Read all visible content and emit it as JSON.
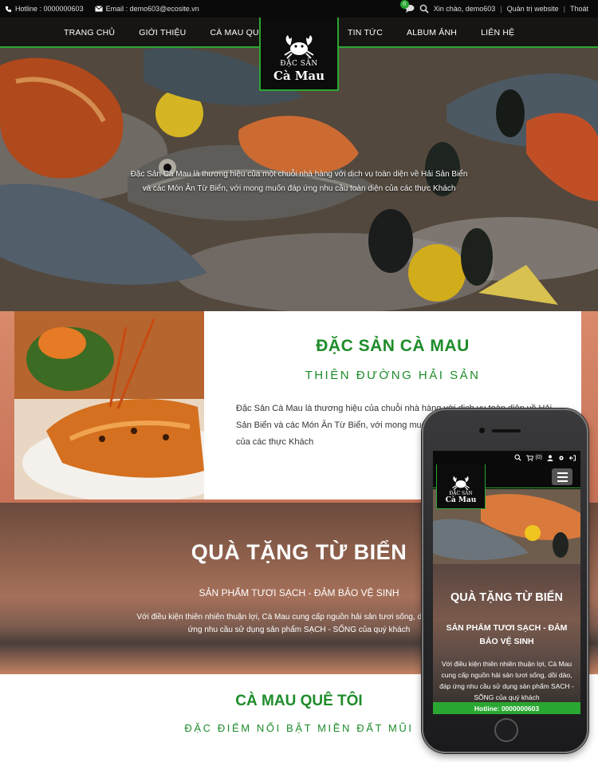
{
  "topbar": {
    "hotline": "Hotline : 0000000603",
    "email": "Email : demo603@ecosite.vn",
    "cart_count": "0",
    "greeting": "Xin chào, demo603",
    "admin_link": "Quản trị website",
    "logout_link": "Thoát",
    "separator": "|"
  },
  "nav": {
    "left_items": [
      "TRANG CHỦ",
      "GIỚI THIỆU",
      "CÀ MAU QUÊ TÔI"
    ],
    "right_items": [
      "TIN TỨC",
      "ALBUM ẢNH",
      "LIÊN HỆ"
    ]
  },
  "logo": {
    "line1": "ĐẶC SẢN",
    "line2": "Cà Mau"
  },
  "hero": {
    "line1": "Đặc Sản Cà Mau là thương hiệu của một chuỗi nhà hàng với dịch vụ toàn diện về Hải Sản Biển",
    "line2": "và các Món Ăn Từ Biển, với mong muốn đáp ứng nhu cầu toàn diện của các thực Khách"
  },
  "about": {
    "title": "ĐẶC SẢN CÀ MAU",
    "subtitle": "THIÊN ĐƯỜNG HẢI SẢN",
    "description": "Đặc Sản Cà Mau là thương hiệu của chuỗi nhà hàng với dịch vụ toàn diện về Hải Sản Biển và các Món Ăn Từ Biển, với mong muốn đáp ứng nhu cầu toàn diện của các thực Khách"
  },
  "gift": {
    "title": "QUÀ TẶNG TỪ BIỂN",
    "subtitle": "SẢN PHẨM TƯƠI SẠCH - ĐẢM BẢO VỆ SINH",
    "description": "Với điều kiện thiên nhiên thuận lợi, Cà Mau cung cấp nguồn hải sản tươi sống, dồi dào, đáp ứng nhu cầu sử dụng sản phẩm SẠCH - SỐNG của quý khách"
  },
  "home_section": {
    "title": "CÀ MAU QUÊ TÔI",
    "subtitle": "ĐẶC ĐIỂM NỔI BẬT MIỀN ĐẤT MŨI"
  },
  "mobile": {
    "cart_label": "(0)",
    "logo_line1": "ĐẶC SẢN",
    "logo_line2": "Cà Mau",
    "gift_title": "QUÀ TẶNG TỪ BIỂN",
    "gift_subtitle": "SẢN PHẨM TƯƠI SẠCH - ĐẢM BẢO VỆ SINH",
    "gift_description": "Với điều kiện thiên nhiên thuận lợi, Cà Mau cung cấp nguồn hải sản tươi sống, dồi dào, đáp ứng nhu cầu sử dụng sản phẩm SẠCH - SỐNG của quý khách",
    "hotline": "Hotline: 0000000603"
  },
  "colors": {
    "accent": "#2aa732",
    "heading_green": "#1e8c2a",
    "topbar": "#0a0a0a"
  }
}
